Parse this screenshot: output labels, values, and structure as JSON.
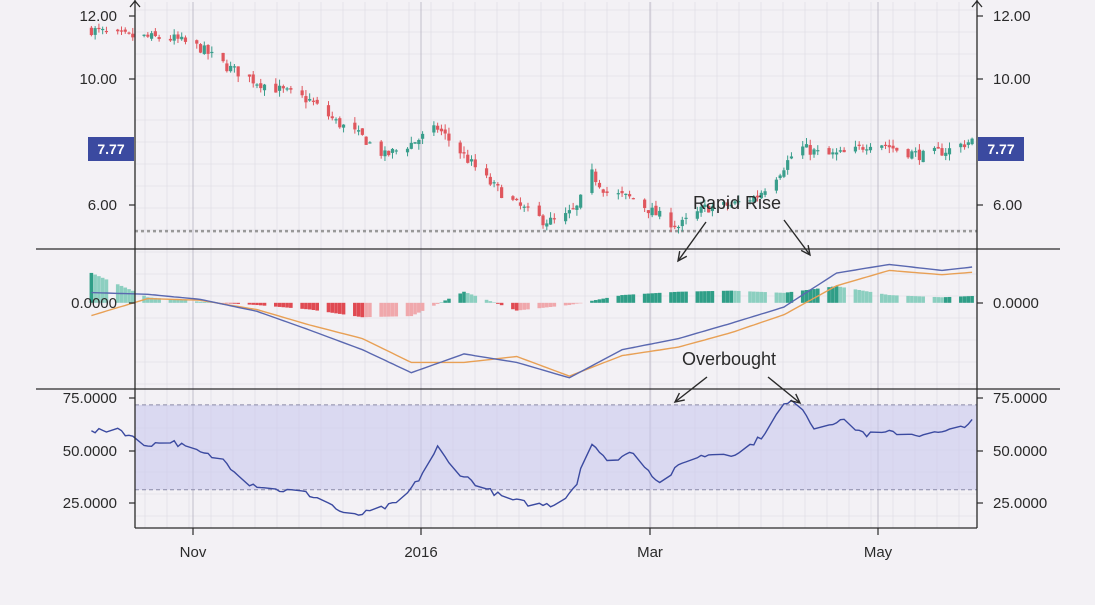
{
  "colors": {
    "background": "#f3f1f5",
    "grid": "#dcd9e2",
    "axis": "#2a2a2a",
    "candle_up": "#3a9e8c",
    "candle_down": "#e0575e",
    "price_tag_bg": "#3b4aa0",
    "macd_line": "#5a68b0",
    "signal_line": "#e8a055",
    "hist_pos_strong": "#2f9e87",
    "hist_pos_weak": "#8ccfc0",
    "hist_neg_strong": "#e04a52",
    "hist_neg_weak": "#f0a8ac",
    "rsi_line": "#3b4aa0",
    "rsi_band": "#c9c9ee",
    "support_line": "#999999"
  },
  "price_tag": "7.77",
  "annotations": {
    "rapid_rise": "Rapid Rise",
    "overbought": "Overbought"
  },
  "x_axis": {
    "labels": [
      "Nov",
      "2016",
      "Mar",
      "May"
    ],
    "range": [
      "2015-10-05",
      "2016-06-04"
    ]
  },
  "chart_data": [
    {
      "type": "candlestick",
      "panel": "price",
      "y_ticks": [
        "12.00",
        "10.00",
        "6.00"
      ],
      "ylim": [
        4.5,
        12.5
      ],
      "last_price": 7.77,
      "support_level": 5.05,
      "grid": true,
      "close_anchors": [
        [
          "2015-10-05",
          11.6
        ],
        [
          "2015-10-12",
          11.4
        ],
        [
          "2015-10-20",
          11.35
        ],
        [
          "2015-10-27",
          11.3
        ],
        [
          "2015-11-03",
          11.0
        ],
        [
          "2015-11-10",
          10.4
        ],
        [
          "2015-11-18",
          9.9
        ],
        [
          "2015-11-25",
          9.6
        ],
        [
          "2015-12-02",
          9.3
        ],
        [
          "2015-12-09",
          8.6
        ],
        [
          "2015-12-16",
          8.1
        ],
        [
          "2015-12-22",
          7.5
        ],
        [
          "2015-12-29",
          7.9
        ],
        [
          "2016-01-05",
          8.4
        ],
        [
          "2016-01-12",
          7.5
        ],
        [
          "2016-01-19",
          6.6
        ],
        [
          "2016-01-26",
          5.9
        ],
        [
          "2016-02-02",
          5.4
        ],
        [
          "2016-02-06",
          5.35
        ],
        [
          "2016-02-11",
          5.8
        ],
        [
          "2016-02-15",
          6.9
        ],
        [
          "2016-02-19",
          6.3
        ],
        [
          "2016-02-26",
          6.1
        ],
        [
          "2016-03-03",
          5.6
        ],
        [
          "2016-03-09",
          5.2
        ],
        [
          "2016-03-16",
          5.8
        ],
        [
          "2016-03-23",
          5.9
        ],
        [
          "2016-03-30",
          6.2
        ],
        [
          "2016-04-05",
          7.0
        ],
        [
          "2016-04-10",
          7.8
        ],
        [
          "2016-04-17",
          7.5
        ],
        [
          "2016-04-24",
          7.6
        ],
        [
          "2016-04-30",
          8.0
        ],
        [
          "2016-05-06",
          7.7
        ],
        [
          "2016-05-13",
          7.5
        ],
        [
          "2016-05-20",
          7.7
        ],
        [
          "2016-05-26",
          8.0
        ],
        [
          "2016-06-01",
          8.9
        ],
        [
          "2016-06-06",
          8.6
        ],
        [
          "2016-06-13",
          8.5
        ],
        [
          "2016-06-20",
          8.3
        ],
        [
          "2016-06-27",
          7.8
        ],
        [
          "2016-07-04",
          7.6
        ],
        [
          "2016-07-12",
          7.7
        ],
        [
          "2016-07-19",
          7.77
        ]
      ]
    },
    {
      "type": "macd",
      "panel": "macd",
      "y_ticks": [
        "0.0000"
      ],
      "ylim": [
        -1.0,
        0.62
      ],
      "macd_anchors": [
        [
          "2015-10-05",
          0.12
        ],
        [
          "2015-10-20",
          0.1
        ],
        [
          "2015-11-03",
          0.04
        ],
        [
          "2015-11-18",
          -0.1
        ],
        [
          "2015-12-02",
          -0.32
        ],
        [
          "2015-12-16",
          -0.55
        ],
        [
          "2015-12-29",
          -0.82
        ],
        [
          "2016-01-12",
          -0.6
        ],
        [
          "2016-01-26",
          -0.7
        ],
        [
          "2016-02-09",
          -0.88
        ],
        [
          "2016-02-23",
          -0.55
        ],
        [
          "2016-03-09",
          -0.42
        ],
        [
          "2016-03-23",
          -0.24
        ],
        [
          "2016-04-06",
          -0.05
        ],
        [
          "2016-04-20",
          0.35
        ],
        [
          "2016-05-04",
          0.45
        ],
        [
          "2016-05-18",
          0.38
        ],
        [
          "2016-06-01",
          0.45
        ],
        [
          "2016-06-15",
          0.45
        ],
        [
          "2016-06-29",
          0.1
        ],
        [
          "2016-07-12",
          -0.05
        ],
        [
          "2016-07-22",
          -0.07
        ]
      ],
      "signal_anchors": [
        [
          "2015-10-05",
          -0.15
        ],
        [
          "2015-10-20",
          0.05
        ],
        [
          "2015-11-03",
          0.03
        ],
        [
          "2015-11-18",
          -0.08
        ],
        [
          "2015-12-02",
          -0.26
        ],
        [
          "2015-12-16",
          -0.42
        ],
        [
          "2015-12-29",
          -0.7
        ],
        [
          "2016-01-12",
          -0.7
        ],
        [
          "2016-01-26",
          -0.63
        ],
        [
          "2016-02-09",
          -0.86
        ],
        [
          "2016-02-23",
          -0.62
        ],
        [
          "2016-03-09",
          -0.52
        ],
        [
          "2016-03-23",
          -0.35
        ],
        [
          "2016-04-06",
          -0.14
        ],
        [
          "2016-04-20",
          0.2
        ],
        [
          "2016-05-04",
          0.38
        ],
        [
          "2016-05-18",
          0.33
        ],
        [
          "2016-06-01",
          0.38
        ],
        [
          "2016-06-15",
          0.4
        ],
        [
          "2016-06-29",
          0.18
        ],
        [
          "2016-07-12",
          0.0
        ],
        [
          "2016-07-22",
          -0.05
        ]
      ]
    },
    {
      "type": "line",
      "panel": "rsi",
      "y_ticks": [
        "75.0000",
        "50.0000",
        "25.0000"
      ],
      "ylim": [
        12,
        77
      ],
      "overbought_level": 70,
      "oversold_level": 30,
      "rsi_anchors": [
        [
          "2015-10-05",
          57
        ],
        [
          "2015-10-12",
          59
        ],
        [
          "2015-10-19",
          51
        ],
        [
          "2015-10-26",
          53
        ],
        [
          "2015-11-02",
          48
        ],
        [
          "2015-11-09",
          44
        ],
        [
          "2015-11-16",
          33
        ],
        [
          "2015-11-23",
          30
        ],
        [
          "2015-11-30",
          29
        ],
        [
          "2015-12-07",
          24
        ],
        [
          "2015-12-12",
          17
        ],
        [
          "2015-12-19",
          20
        ],
        [
          "2015-12-26",
          24
        ],
        [
          "2015-12-31",
          35
        ],
        [
          "2016-01-05",
          50
        ],
        [
          "2016-01-09",
          40
        ],
        [
          "2016-01-16",
          32
        ],
        [
          "2016-01-23",
          26
        ],
        [
          "2016-01-30",
          23
        ],
        [
          "2016-02-06",
          23
        ],
        [
          "2016-02-11",
          33
        ],
        [
          "2016-02-14",
          55
        ],
        [
          "2016-02-19",
          43
        ],
        [
          "2016-02-26",
          48
        ],
        [
          "2016-03-04",
          33
        ],
        [
          "2016-03-11",
          44
        ],
        [
          "2016-03-18",
          47
        ],
        [
          "2016-03-25",
          47
        ],
        [
          "2016-03-31",
          55
        ],
        [
          "2016-04-06",
          70
        ],
        [
          "2016-04-10",
          72
        ],
        [
          "2016-04-14",
          59
        ],
        [
          "2016-04-21",
          63
        ],
        [
          "2016-04-28",
          56
        ],
        [
          "2016-05-05",
          57
        ],
        [
          "2016-05-12",
          56
        ],
        [
          "2016-05-19",
          57
        ],
        [
          "2016-05-26",
          62
        ],
        [
          "2016-06-01",
          76
        ],
        [
          "2016-06-05",
          63
        ],
        [
          "2016-06-12",
          57
        ],
        [
          "2016-06-19",
          59
        ],
        [
          "2016-06-26",
          52
        ],
        [
          "2016-07-03",
          44
        ],
        [
          "2016-07-10",
          43
        ],
        [
          "2016-07-17",
          48
        ],
        [
          "2016-07-22",
          51
        ]
      ]
    }
  ]
}
